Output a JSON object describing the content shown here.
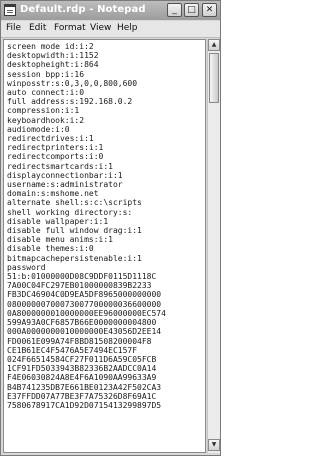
{
  "window": {
    "title": "Default.rdp - Notepad",
    "controls": {
      "minimize": "_",
      "maximize": "□",
      "close": "✕"
    }
  },
  "menu": {
    "items": [
      "File",
      "Edit",
      "Format",
      "View",
      "Help"
    ]
  },
  "editor": {
    "lines": [
      "screen mode id:i:2",
      "desktopwidth:i:1152",
      "desktopheight:i:864",
      "session bpp:i:16",
      "winposstr:s:0,3,0,0,800,600",
      "auto connect:i:0",
      "full address:s:192.168.0.2",
      "compression:i:1",
      "keyboardhook:i:2",
      "audiomode:i:0",
      "redirectdrives:i:1",
      "redirectprinters:i:1",
      "redirectcomports:i:0",
      "redirectsmartcards:i:1",
      "displayconnectionbar:i:1",
      "username:s:administrator",
      "domain:s:mshome.net",
      "alternate shell:s:c:\\scripts",
      "shell working directory:s:",
      "disable wallpaper:i:1",
      "disable full window drag:i:1",
      "disable menu anims:i:1",
      "disable themes:i:0",
      "bitmapcachepersistenable:i:1",
      "password",
      "51:b:01000000D08C9DDF0115D1118C",
      "7A00C04FC297EB01000000839B2233",
      "FB3DC46904C0D9EA5DF8965000000000",
      "08000000700073007700000036600000",
      "0A8000000010000000EE96000000EC574",
      "599A93A0CF6857B66E0000000004800",
      "000A0000000010000000E43056D2EE14",
      "FD0061E099A74F8BD81508200004F8",
      "CE1B61EC4F5476A5E7494EC157F",
      "024F66514584CF27F011D6A59C05FCB",
      "1CF91FD5033943B82336B2AADCC0A14",
      "F4E06030824A8E4F6A1090AA99633A9",
      "B4B741235DB7E661BE0123A42F502CA3",
      "E37FFDD07A77BE3F7A75326D8F69A1C",
      "7580678917CA1D92D0715413299897D5"
    ]
  },
  "colors": {
    "titlebar": "#a8a8a8",
    "title_text": "#ffffff",
    "editor_bg": "#ffffff",
    "text": "#1a1a1a"
  },
  "icons": {
    "app": "notepad-icon",
    "scroll_up": "scroll-up-arrow-icon",
    "scroll_down": "scroll-down-arrow-icon"
  }
}
